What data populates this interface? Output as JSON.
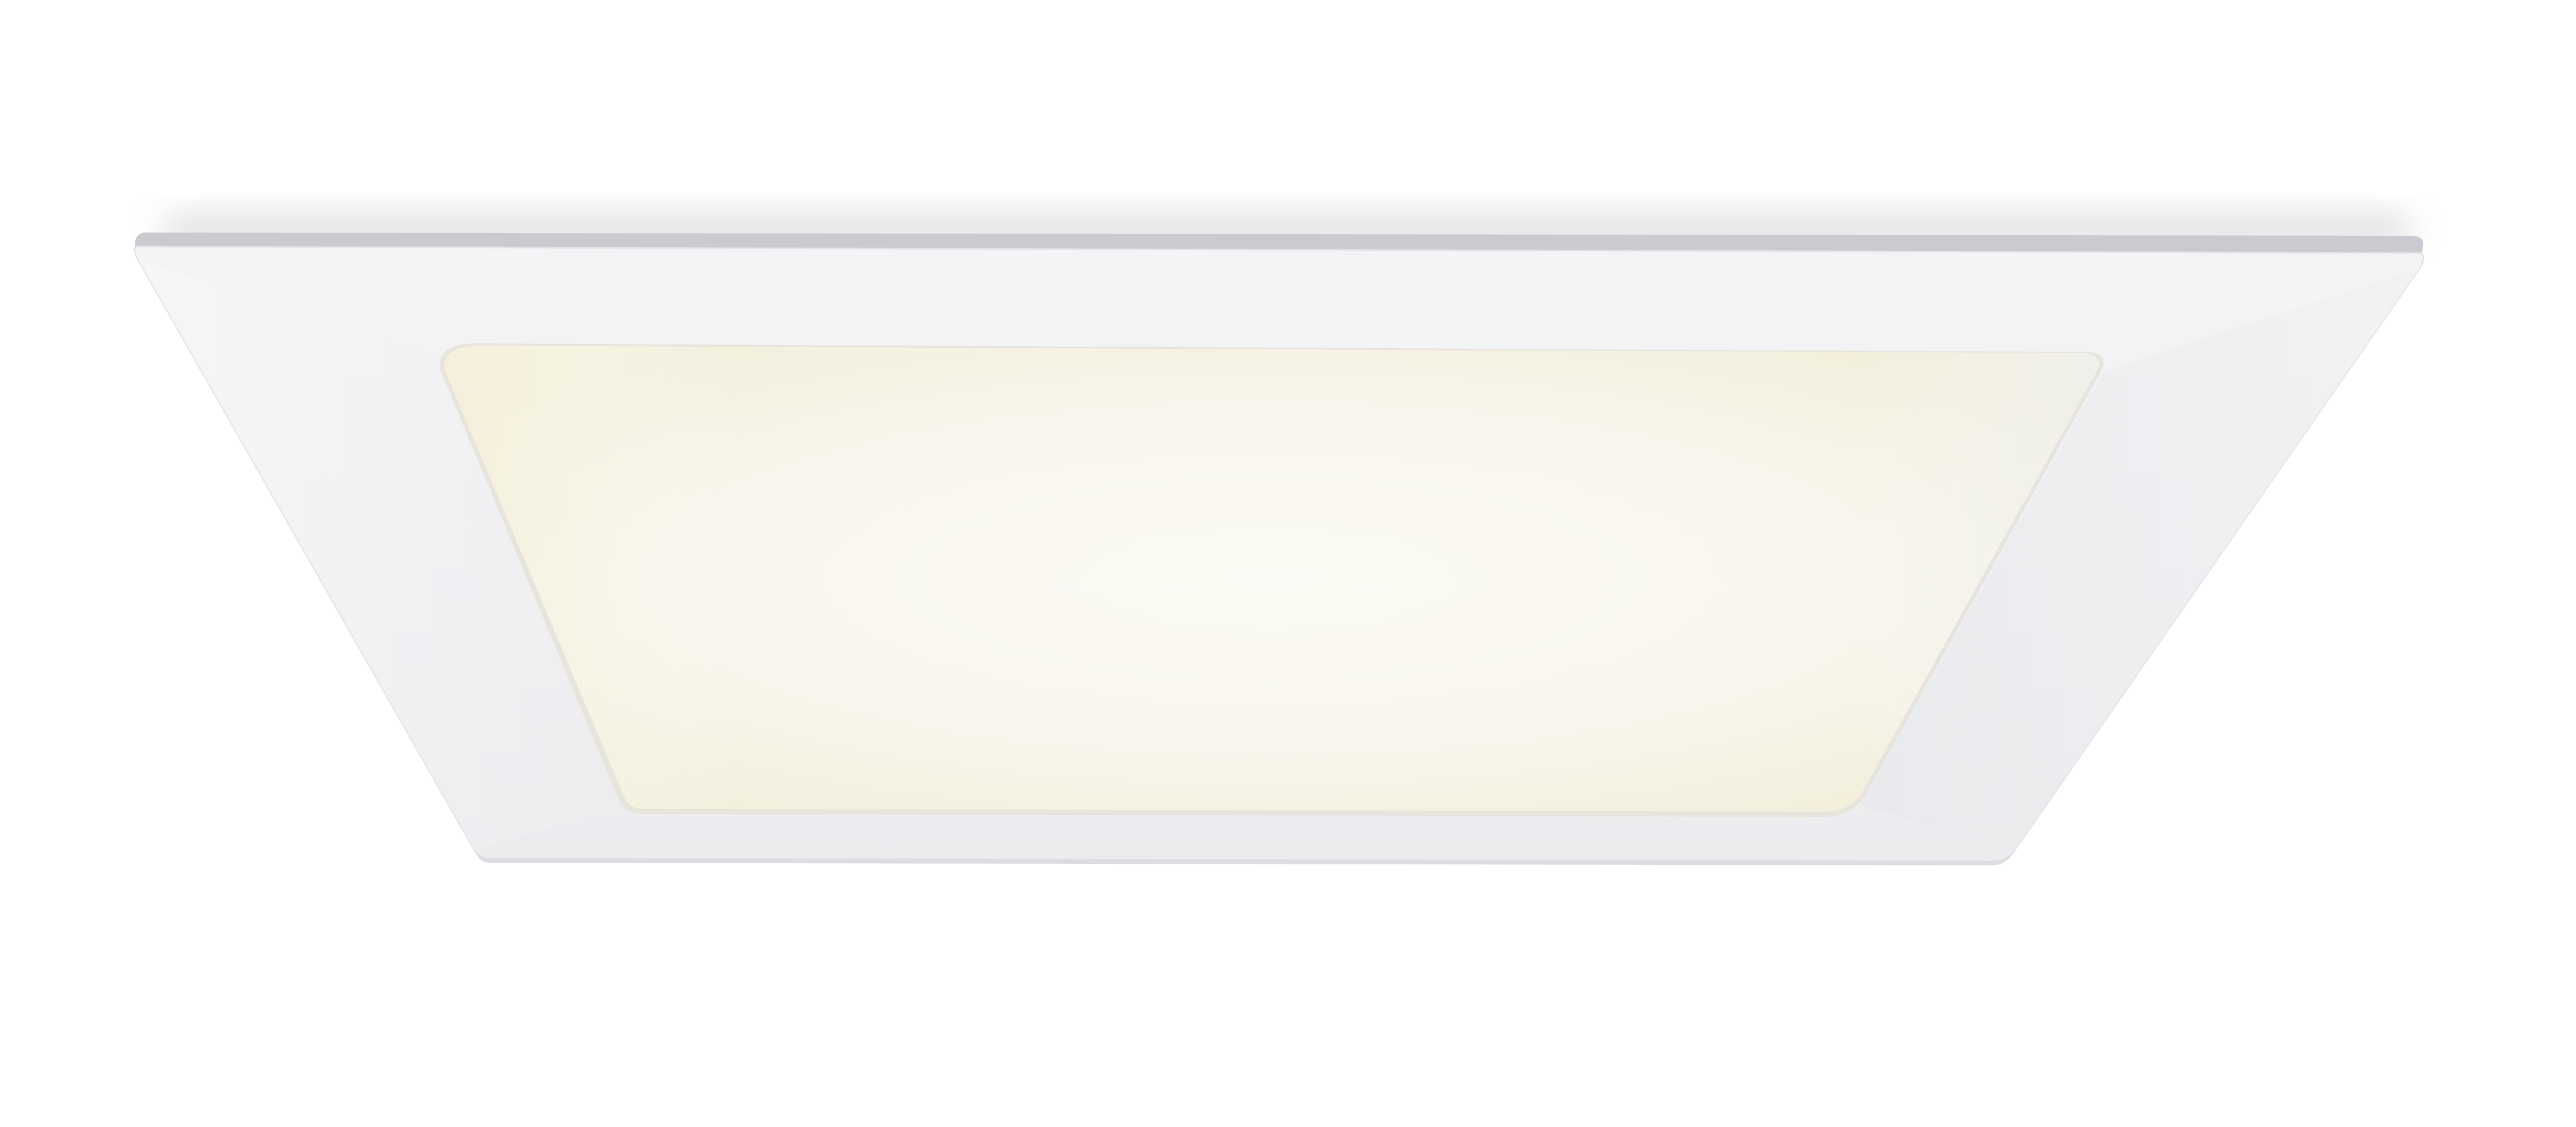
{
  "scene": {
    "subject": "square-led-panel-light",
    "colors": {
      "background": "#ffffff",
      "frame_top": "#f3f3f5",
      "frame_side": "#ebebee",
      "frame_edge": "#b9bbc0",
      "diffuser_warm": "#f7f3e4",
      "diffuser_center": "#fbfaf4",
      "diffuser_cool": "#f4f5f3",
      "shadow": "#c4c6cb"
    }
  }
}
